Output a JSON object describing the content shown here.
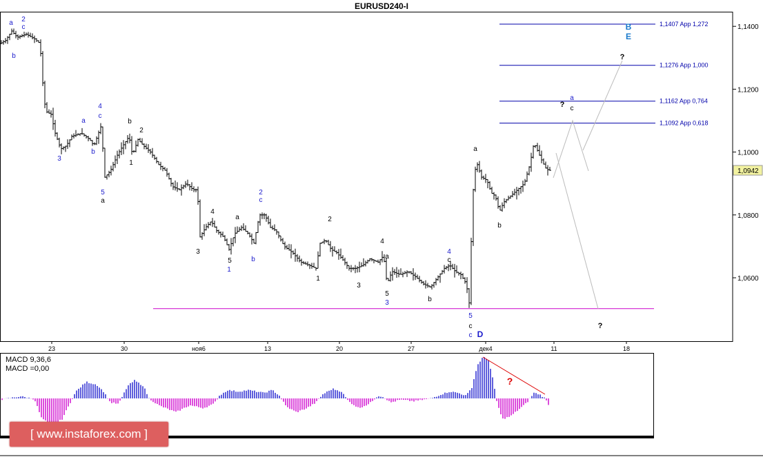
{
  "chart_data": {
    "type": "candlestick",
    "title": "EURUSD240-I",
    "current_price": "1,0942",
    "y_ticks": [
      "1,1400",
      "1,1200",
      "1,1000",
      "1,0800",
      "1,0600"
    ],
    "y_tick_values": [
      1.14,
      1.12,
      1.1,
      1.08,
      1.06
    ],
    "x_ticks": [
      "23",
      "30",
      "ноя6",
      "13",
      "20",
      "27",
      "дек4",
      "11",
      "18"
    ],
    "fib_levels": [
      {
        "price": 1.1407,
        "label": "1,1407 App 1,272"
      },
      {
        "price": 1.1276,
        "label": "1,1276 App 1,000"
      },
      {
        "price": 1.1162,
        "label": "1,1162 App 0,764"
      },
      {
        "price": 1.1092,
        "label": "1,1092 App 0,618"
      }
    ],
    "support_level": 1.0502,
    "wave_labels": [
      "a",
      "2",
      "c",
      "b",
      "3",
      "4",
      "c",
      "a",
      "b",
      "5",
      "a",
      "b",
      "2",
      "1",
      "3",
      "4",
      "5",
      "1",
      "a",
      "b",
      "2",
      "c",
      "1",
      "2",
      "3",
      "4",
      "a",
      "5",
      "3",
      "4",
      "c",
      "b",
      "5",
      "c",
      "c",
      "D",
      "a",
      "b",
      "a",
      "c",
      "?",
      "?",
      "?",
      "B",
      "E"
    ],
    "macd": {
      "label_params": "MACD 9,36,6",
      "label_value": "MACD =0,00",
      "annotation": "?"
    },
    "colors": {
      "fib_line": "#0000aa",
      "support_line": "#cc00cc",
      "macd_positive": "#1a1acc",
      "macd_negative": "#cc00cc",
      "trendline": "#dd0000",
      "wave_blue": "#1a1acc",
      "wave_black": "#000000"
    }
  },
  "watermark": {
    "text": "[ www.instaforex.com ]"
  }
}
